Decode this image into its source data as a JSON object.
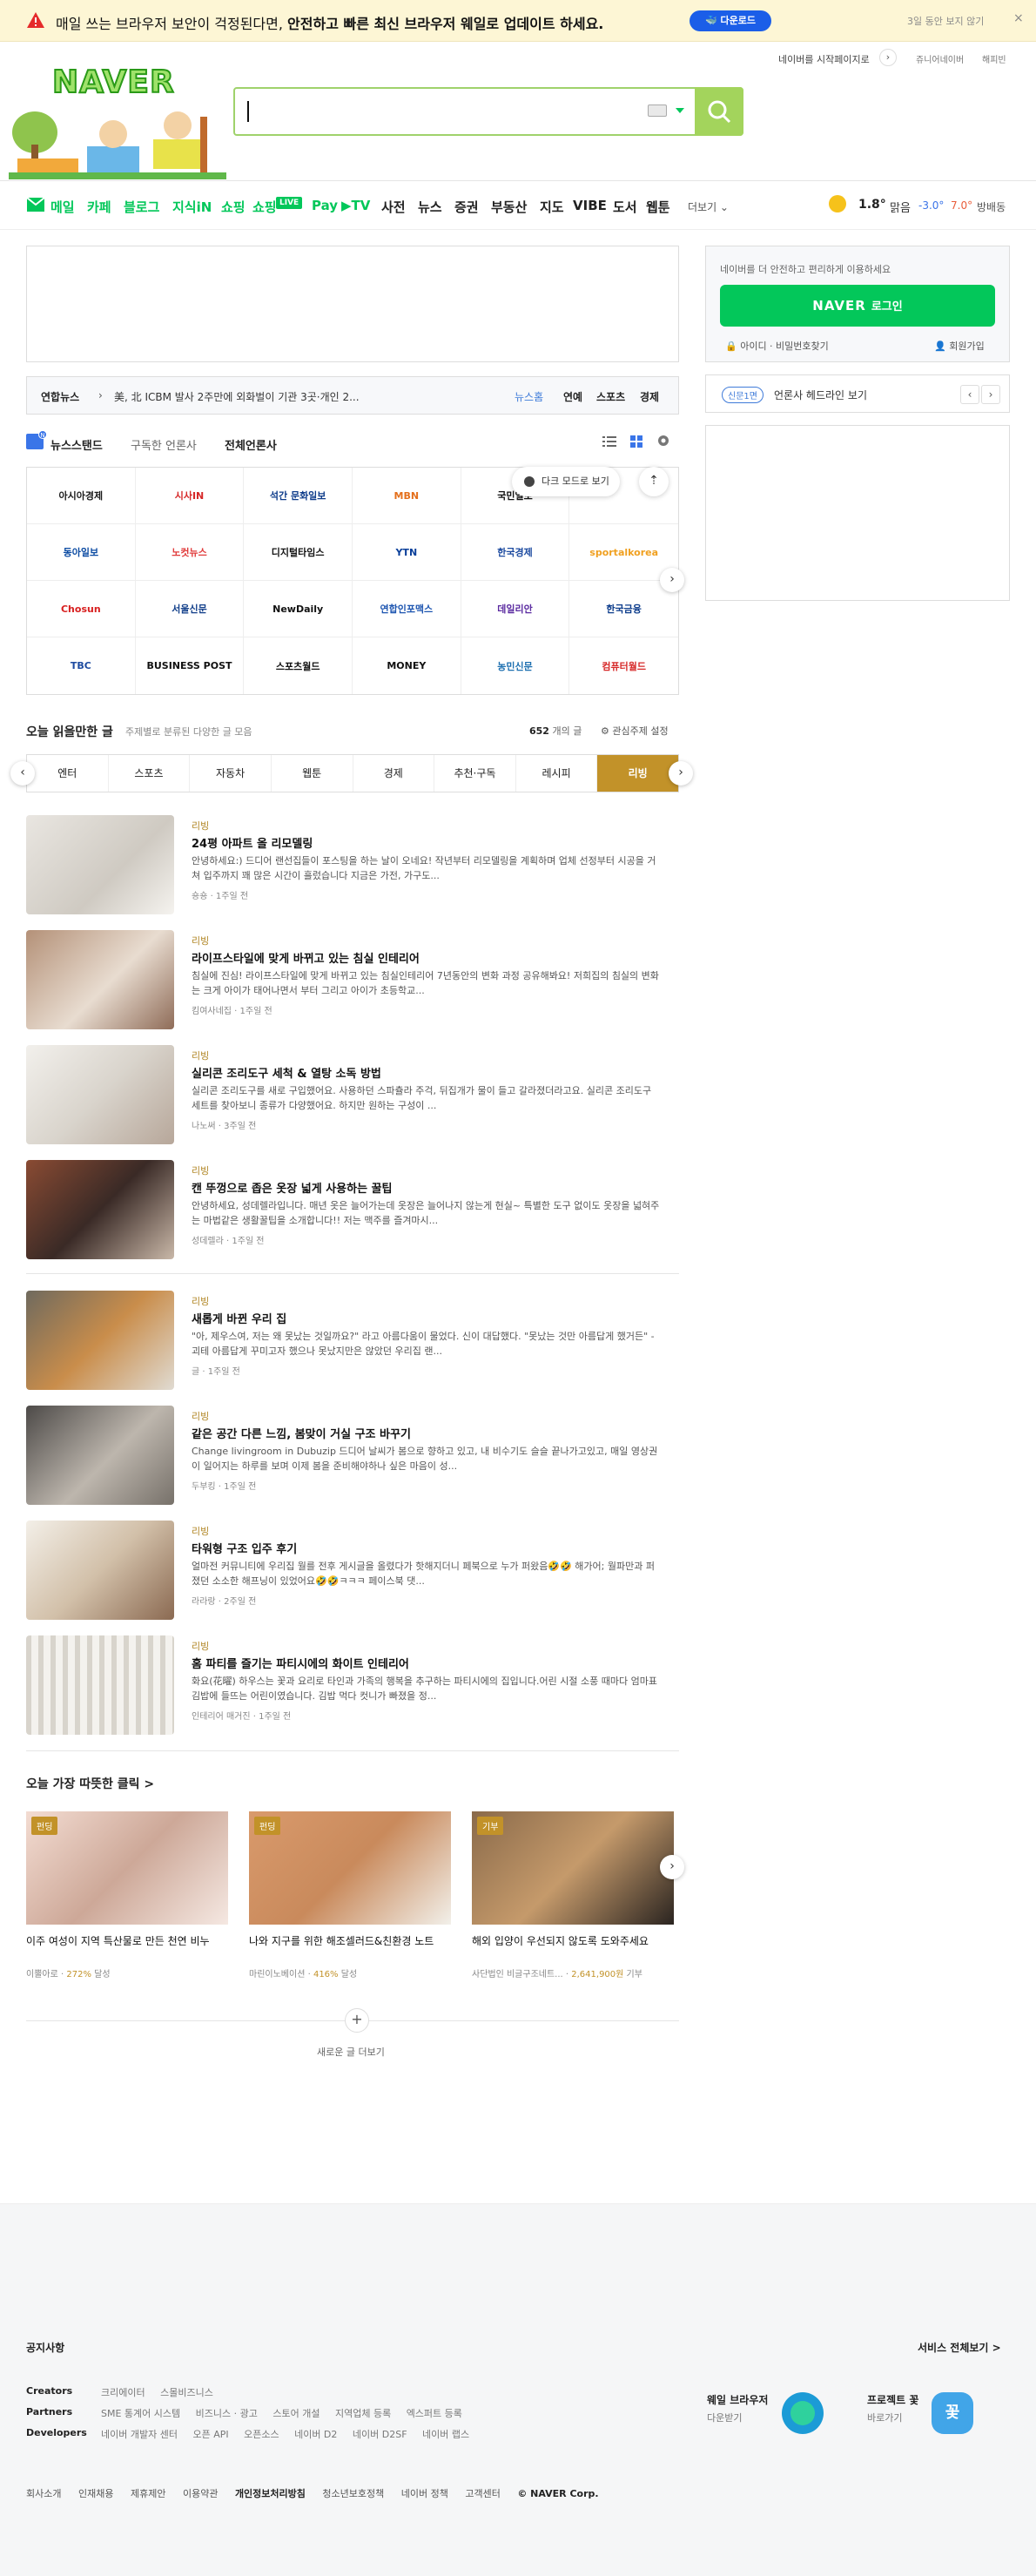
{
  "banner": {
    "message_plain": "매일 쓰는 브라우저 보안이 걱정된다면,",
    "message_bold": "안전하고 빠른 최신 브라우저 웨일로 업데이트 하세요.",
    "download_label": "다운로드",
    "hide_label": "3일 동안 보지 않기",
    "close_label": "×"
  },
  "header": {
    "logo": "NAVER",
    "set_home": "네이버를 시작페이지로",
    "junior": "쥬니어네이버",
    "happybean": "해피빈"
  },
  "services": {
    "items": [
      "메일",
      "카페",
      "블로그",
      "지식iN",
      "쇼핑",
      "쇼핑LIVE",
      "Pay",
      "▶TV",
      "사전",
      "뉴스",
      "증권",
      "부동산",
      "지도",
      "VIBE",
      "도서",
      "웹툰"
    ],
    "live_badge": "LIVE",
    "more": "더보기 ⌄"
  },
  "weather": {
    "temp": "1.8°",
    "condition": "맑음",
    "low": "-3.0°",
    "high": "7.0°",
    "district": "방배동"
  },
  "newsbar": {
    "source": "연합뉴스",
    "headline": "美, 北 ICBM 발사 2주만에 외화벌이 기관 3곳·개인 2...",
    "news_home": "뉴스홈",
    "entertainment": "연예",
    "sports": "스포츠",
    "economy": "경제"
  },
  "newsstand": {
    "badge": "N",
    "title": "뉴스스탠드",
    "subscribed": "구독한 언론사",
    "all": "전체언론사",
    "dark_mode": "다크 모드로 보기",
    "press": [
      "아시아경제",
      "시사IN",
      "석간 문화일보",
      "MBN",
      "국민일보",
      "",
      "동아일보",
      "노컷뉴스",
      "디지털타임스",
      "YTN",
      "한국경제",
      "sportalkorea",
      "Chosun",
      "서울신문",
      "NewDaily",
      "연합인포맥스",
      "데일리안",
      "한국금융",
      "TBC",
      "BUSINESS POST",
      "스포츠월드",
      "MONEY",
      "농민신문",
      "컴퓨터월드"
    ]
  },
  "today": {
    "title": "오늘 읽을만한 글",
    "subtitle": "주제별로 분류된 다양한 글 모음",
    "count_num": "652",
    "count_unit": "개의 글",
    "settings": "관심주제 설정",
    "categories": [
      "엔터",
      "스포츠",
      "자동차",
      "웹툰",
      "경제",
      "추천·구독",
      "레시피",
      "리빙"
    ],
    "articles": [
      {
        "cat": "리빙",
        "title": "24평 아파트 올 리모델링",
        "desc": "안녕하세요:) 드디어 랜선집들이 포스팅을 하는 날이 오네요! 작년부터 리모델링을 계획하며 업체 선정부터 시공을 거쳐 입주까지 꽤 많은 시간이 흘렀습니다 지금은 가전, 가구도...",
        "meta": "숑숑 · 1주일 전"
      },
      {
        "cat": "리빙",
        "title": "라이프스타일에 맞게 바뀌고 있는 침실 인테리어",
        "desc": "침실에 진심! 라이프스타일에 맞게 바뀌고 있는 침실인테리어 7년동안의 변화 과정 공유해봐요! 저희집의 침실의 변화는 크게 아이가 태어나면서 부터 그리고 아이가 초등학교...",
        "meta": "킴여사네집 · 1주일 전"
      },
      {
        "cat": "리빙",
        "title": "실리콘 조리도구 세척 & 열탕 소독 방법",
        "desc": "실리콘 조리도구를 새로 구입했어요. 사용하던 스파츌라 주걱, 뒤집개가 물이 들고 갈라졌더라고요. 실리콘 조리도구 세트를 찾아보니 종류가 다양했어요. 하지만 원하는 구성이 ...",
        "meta": "나노써 · 3주일 전"
      },
      {
        "cat": "리빙",
        "title": "캔 뚜껑으로 좁은 옷장 넓게 사용하는 꿀팁",
        "desc": "안녕하세요, 성데렐라입니다. 매년 옷은 늘어가는데 옷장은 늘어나지 않는게 현실~ 특별한 도구 없이도 옷장을 넓혀주는 마법같은 생활꿀팁을 소개합니다!! 저는 맥주를 즐겨마시...",
        "meta": "성데렐라 · 1주일 전"
      },
      {
        "cat": "리빙",
        "title": "새롭게 바뀐 우리 집",
        "desc": "\"아, 제우스여, 저는 왜 못났는 것일까요?\" 라고 아름다움이 물었다. 신이 대답했다. \"못났는 것만 아름답게 했거든\" - 괴테 아름답게 꾸미고자 했으나 못났지만은 않았던 우리집 랜...",
        "meta": "글 · 1주일 전"
      },
      {
        "cat": "리빙",
        "title": "같은 공간 다른 느낌, 봄맞이 거실 구조 바꾸기",
        "desc": "Change livingroom in Dubuzip 드디어 날씨가 봄으로 향하고 있고, 내 비수기도 슬슬 끝나가고있고, 매일 영상권이 일어지는 하루를 보며 이제 봄을 준비해야하나 싶은 마음이 성...",
        "meta": "두부킹 · 1주일 전"
      },
      {
        "cat": "리빙",
        "title": "타워형 구조 입주 후기",
        "desc": "얼마전 커뮤니티에 우리집 월를 전후 게시글을 올렸다가 핫해지더니 페북으로 누가 퍼왔음🤣🤣 해가어; 월파만과 퍼졌던 소소한 해프닝이 있었어요🤣🤣ㅋㅋㅋ 페이스북 댓...",
        "meta": "라라랑 · 2주일 전"
      },
      {
        "cat": "리빙",
        "title": "홈 파티를 즐기는 파티시에의 화이트 인테리어",
        "desc": "화요(花曜) 하우스는 꽃과 요리로 타인과 가족의 행복을 추구하는 파티시에의 집입니다.어린 시절 소풍 때마다 엄마표 김밥에 들뜨는 어린이였습니다. 김밥 먹다 컷니가 빠졌을 정...",
        "meta": "인테리어 매거진 · 1주일 전"
      }
    ]
  },
  "warm": {
    "title": "오늘 가장 따뜻한 클릭 >",
    "cards": [
      {
        "tag": "펀딩",
        "title": "이주 여성이 지역 특산물로 만든 천연 비누",
        "org": "이뿔아로",
        "pct": "272%",
        "suffix": "달성"
      },
      {
        "tag": "펀딩",
        "title": "나와 지구를 위한 해조셀러드&친환경 노트",
        "org": "마린이노베이션",
        "pct": "416%",
        "suffix": "달성"
      },
      {
        "tag": "기부",
        "title": "해외 입양이 우선되지 않도록 도와주세요",
        "org": "사단법인 비글구조네트...",
        "pct": "2,641,900원",
        "suffix": "기부"
      }
    ],
    "more": "새로운 글 더보기"
  },
  "login": {
    "text": "네이버를 더 안전하고 편리하게 이용하세요",
    "brand": "NAVER",
    "button": "로그인",
    "find": "아이디 · 비밀번호찾기",
    "join": "회원가입"
  },
  "subs": {
    "badge": "신문1면",
    "text": "언론사 헤드라인 보기",
    "prev": "‹",
    "next": "›"
  },
  "footer": {
    "notice": "공지사항",
    "all_services": "서비스 전체보기 >",
    "rows": [
      {
        "label": "Creators",
        "items": [
          "크리에이터",
          "스몰비즈니스"
        ]
      },
      {
        "label": "Partners",
        "items": [
          "SME 통계어 시스템",
          "비즈니스 · 광고",
          "스토어 개설",
          "지역업체 등록",
          "엑스퍼트 등록"
        ]
      },
      {
        "label": "Developers",
        "items": [
          "네이버 개발자 센터",
          "오픈 API",
          "오픈소스",
          "네이버 D2",
          "네이버 D2SF",
          "네이버 랩스"
        ]
      }
    ],
    "whale": {
      "title": "웨일 브라우저",
      "sub": "다운받기"
    },
    "project": {
      "title": "프로젝트 꽃",
      "sub": "바로가기",
      "glyph": "꽃"
    },
    "bottom": [
      "회사소개",
      "인재채용",
      "제휴제안",
      "이용약관",
      "개인정보처리방침",
      "청소년보호정책",
      "네이버 정책",
      "고객센터",
      "© NAVER Corp."
    ]
  }
}
